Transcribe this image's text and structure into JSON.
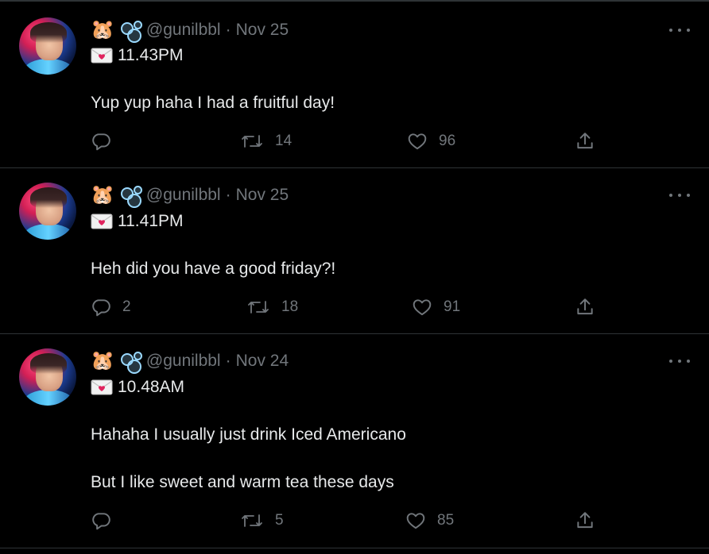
{
  "tweets": [
    {
      "emoji_hamster": "🐹",
      "handle": "@gunilbbl",
      "separator": "·",
      "date": "Nov 25",
      "time": "11.43PM",
      "text_lines": [
        "Yup yup haha I had a fruitful day!"
      ],
      "reply_count": "",
      "retweet_count": "14",
      "like_count": "96"
    },
    {
      "emoji_hamster": "🐹",
      "handle": "@gunilbbl",
      "separator": "·",
      "date": "Nov 25",
      "time": "11.41PM",
      "text_lines": [
        "Heh did you have a good friday?!"
      ],
      "reply_count": "2",
      "retweet_count": "18",
      "like_count": "91"
    },
    {
      "emoji_hamster": "🐹",
      "handle": "@gunilbbl",
      "separator": "·",
      "date": "Nov 24",
      "time": "10.48AM",
      "text_lines": [
        "Hahaha I usually just drink Iced Americano",
        "But I like sweet and warm tea these days"
      ],
      "reply_count": "",
      "retweet_count": "5",
      "like_count": "85"
    }
  ],
  "colors": {
    "background": "#000000",
    "text": "#e7e9ea",
    "muted": "#71767b",
    "border": "#2f3336"
  },
  "icons": [
    "more-icon",
    "reply-icon",
    "retweet-icon",
    "like-icon",
    "share-icon",
    "envelope-heart-icon",
    "bubbles-icon",
    "hamster-icon"
  ]
}
